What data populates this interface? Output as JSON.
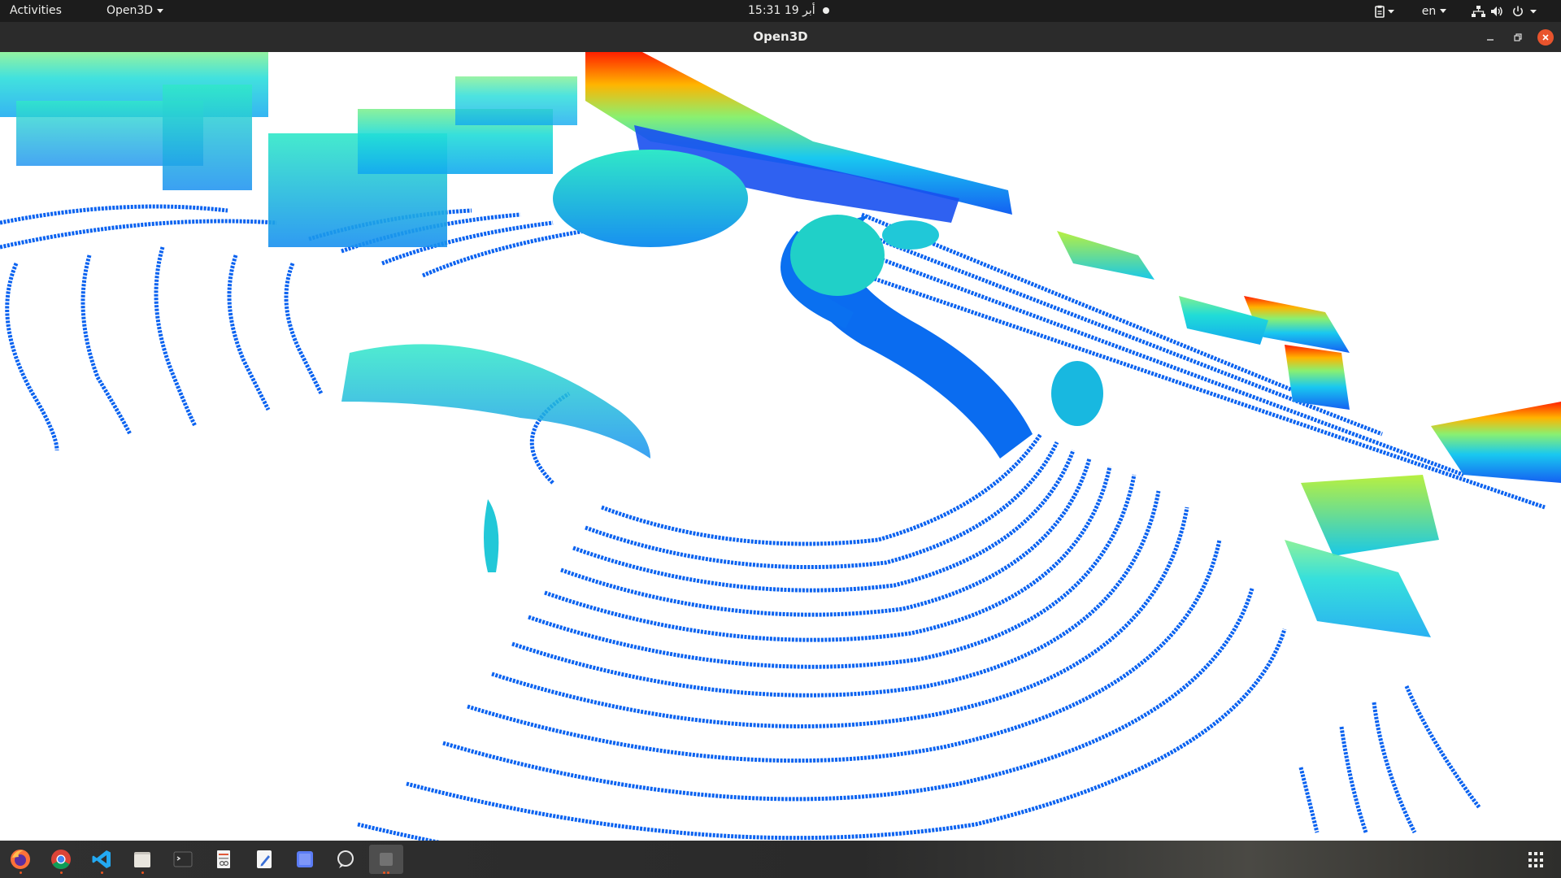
{
  "topbar": {
    "activities": "Activities",
    "app_menu": "Open3D",
    "clock": "أبر 19  15:31",
    "keyboard_layout": "en"
  },
  "window": {
    "title": "Open3D"
  },
  "colors": {
    "topbar_bg": "#1c1c1c",
    "header_bg": "#2b2b2b",
    "close_button": "#e9542d",
    "viewport_bg": "#ffffff",
    "ground_points": "#0a62f0",
    "running_indicator": "#e95420"
  },
  "dock": {
    "items": [
      {
        "name": "firefox-icon",
        "running": true
      },
      {
        "name": "chrome-icon",
        "running": true
      },
      {
        "name": "vscode-icon",
        "running": true
      },
      {
        "name": "files-icon",
        "running": true
      },
      {
        "name": "terminal-icon",
        "running": false
      },
      {
        "name": "document-viewer-icon",
        "running": false
      },
      {
        "name": "text-editor-icon",
        "running": false
      },
      {
        "name": "screenshot-icon",
        "running": false
      },
      {
        "name": "chat-icon",
        "running": false
      },
      {
        "name": "open3d-icon",
        "running": true
      }
    ],
    "show_applications": "show-applications-icon"
  }
}
